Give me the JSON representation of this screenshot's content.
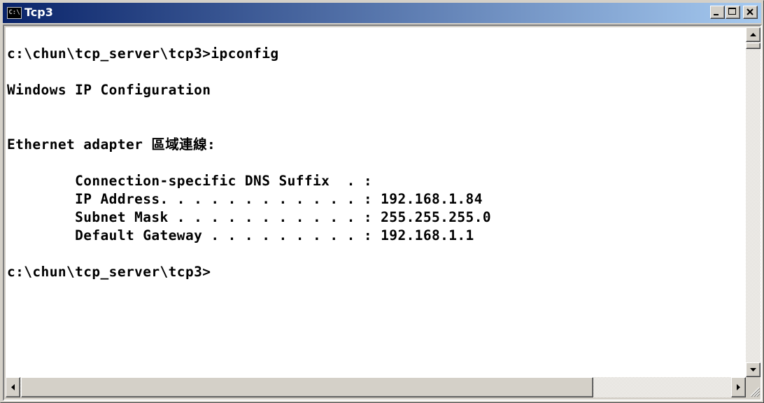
{
  "window": {
    "title": "Tcp3",
    "icon": "cmd-icon",
    "icon_text": "C:\\"
  },
  "console": {
    "lines": [
      "",
      "c:\\chun\\tcp_server\\tcp3>ipconfig",
      "",
      "Windows IP Configuration",
      "",
      "",
      "Ethernet adapter 區域連線:",
      "",
      "        Connection-specific DNS Suffix  . :",
      "        IP Address. . . . . . . . . . . . : 192.168.1.84",
      "        Subnet Mask . . . . . . . . . . . : 255.255.255.0",
      "        Default Gateway . . . . . . . . . : 192.168.1.1",
      "",
      "c:\\chun\\tcp_server\\tcp3>"
    ]
  },
  "colors": {
    "title_start": "#0a246a",
    "title_end": "#a6caf0",
    "chrome": "#d4d0c8",
    "console_bg": "#ffffff",
    "console_fg": "#000000"
  }
}
